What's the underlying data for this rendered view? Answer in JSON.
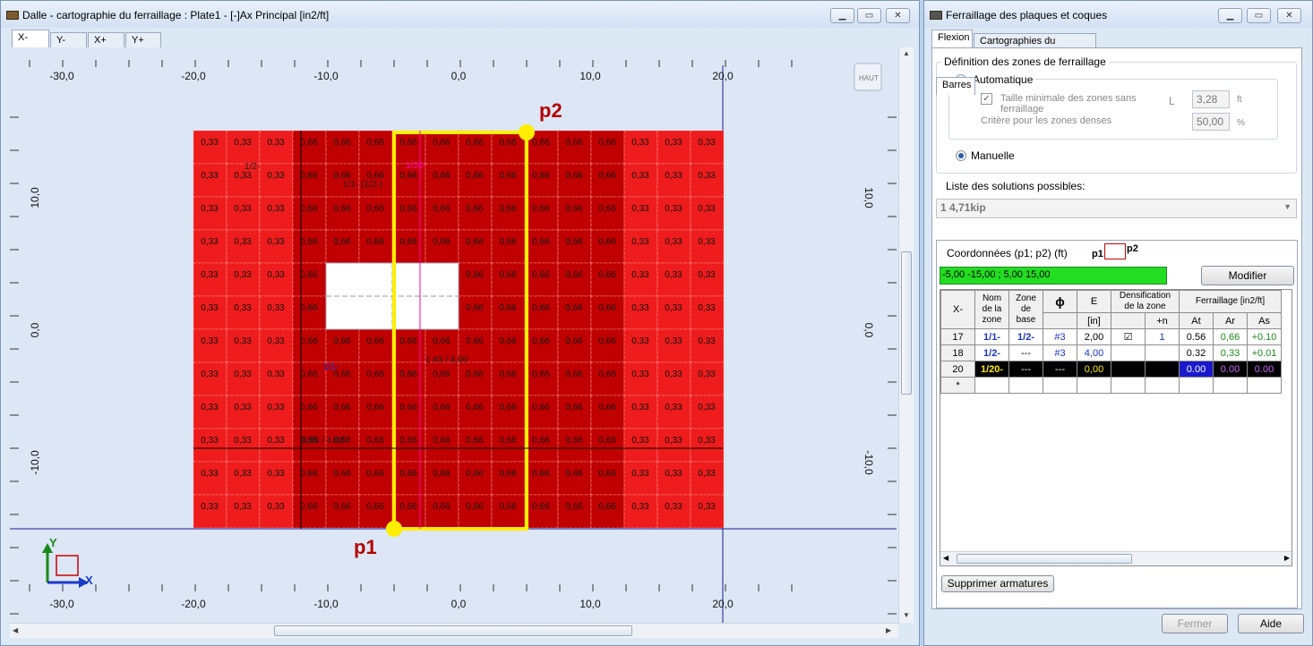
{
  "left_window": {
    "title": "Dalle - cartographie du ferraillage : Plate1 - [-]Ax Principal [in2/ft]",
    "controls": [
      "▁",
      "▭",
      "✕"
    ],
    "tabs": [
      "X-",
      "Y-",
      "X+",
      "Y+"
    ],
    "haut_label": "HAUT",
    "axis_top": [
      "-30,0",
      "-20,0",
      "-10,0",
      "0,0",
      "10,0",
      "20,0"
    ],
    "axis_bottom": [
      "-30,0",
      "-20,0",
      "-10,0",
      "0,0",
      "10,0",
      "20,0"
    ],
    "axis_left": [
      "10,0",
      "0,0",
      "-10,0"
    ],
    "axis_right": [
      "10,0",
      "0,0",
      "-10,0"
    ],
    "p1_label": "p1",
    "p2_label": "p2",
    "annotations": {
      "a1": "1/2-",
      "a2": "1/1- (1/2-)",
      "a3": "1/20-",
      "a4": "1/1-",
      "a5": "1 #3 / 4,00",
      "a6": "0,66 / 4,00"
    },
    "axis_icon": {
      "y": "Y",
      "x": "X"
    },
    "grid": {
      "rows": [
        [
          "0,33",
          "0,33",
          "0,33",
          "0,66",
          "0,66",
          "0,66",
          "0,66",
          "0,66",
          "0,66",
          "0,66",
          "0,66",
          "0,66",
          "0,66",
          "0,33",
          "0,33",
          "0,33"
        ],
        [
          "0,33",
          "0,33",
          "0,33",
          "0,66",
          "0,66",
          "0,66",
          "0,66",
          "0,66",
          "0,66",
          "0,66",
          "0,66",
          "0,66",
          "0,66",
          "0,33",
          "0,33",
          "0,33"
        ],
        [
          "0,33",
          "0,33",
          "0,33",
          "0,66",
          "0,66",
          "0,66",
          "0,66",
          "0,66",
          "0,66",
          "0,66",
          "0,66",
          "0,66",
          "0,66",
          "0,33",
          "0,33",
          "0,33"
        ],
        [
          "0,33",
          "0,33",
          "0,33",
          "0,66",
          "0,66",
          "0,66",
          "0,66",
          "0,66",
          "0,66",
          "0,66",
          "0,66",
          "0,66",
          "0,66",
          "0,33",
          "0,33",
          "0,33"
        ],
        [
          "0,33",
          "0,33",
          "0,33",
          "0,66",
          "",
          "",
          "",
          "",
          "0,66",
          "0,66",
          "0,66",
          "0,66",
          "0,66",
          "0,33",
          "0,33",
          "0,33"
        ],
        [
          "0,33",
          "0,33",
          "0,33",
          "0,66",
          "",
          "",
          "",
          "",
          "0,66",
          "0,66",
          "0,66",
          "0,66",
          "0,66",
          "0,33",
          "0,33",
          "0,33"
        ],
        [
          "0,33",
          "0,33",
          "0,33",
          "0,66",
          "0,66",
          "0,66",
          "0,66",
          "0,66",
          "0,66",
          "0,66",
          "0,66",
          "0,66",
          "0,66",
          "0,33",
          "0,33",
          "0,33"
        ],
        [
          "0,33",
          "0,33",
          "0,33",
          "0,66",
          "0,66",
          "0,66",
          "0,66",
          "0,66",
          "0,66",
          "0,66",
          "0,66",
          "0,66",
          "0,66",
          "0,33",
          "0,33",
          "0,33"
        ],
        [
          "0,33",
          "0,33",
          "0,33",
          "0,66",
          "0,66",
          "0,66",
          "0,66",
          "0,66",
          "0,66",
          "0,66",
          "0,66",
          "0,66",
          "0,66",
          "0,33",
          "0,33",
          "0,33"
        ],
        [
          "0,33",
          "0,33",
          "0,33",
          "0,66",
          "0,66",
          "0,66",
          "0,66",
          "0,66",
          "0,66",
          "0,66",
          "0,66",
          "0,66",
          "0,66",
          "0,33",
          "0,33",
          "0,33"
        ],
        [
          "0,33",
          "0,33",
          "0,33",
          "0,66",
          "0,66",
          "0,66",
          "0,66",
          "0,66",
          "0,66",
          "0,66",
          "0,66",
          "0,66",
          "0,66",
          "0,33",
          "0,33",
          "0,33"
        ],
        [
          "0,33",
          "0,33",
          "0,33",
          "0,66",
          "0,66",
          "0,66",
          "0,66",
          "0,66",
          "0,66",
          "0,66",
          "0,66",
          "0,66",
          "0,66",
          "0,33",
          "0,33",
          "0,33"
        ]
      ],
      "colors": {
        "light": "#ee1c1c",
        "dark": "#c00000",
        "hole": "#dce6f4",
        "highlight": "#ffee00"
      }
    }
  },
  "right_window": {
    "title": "Ferraillage des plaques et coques",
    "controls": [
      "▁",
      "▭",
      "✕"
    ],
    "tabs": [
      "Flexion",
      "Cartographies du ferraillage"
    ],
    "group_title": "Définition des zones de ferraillage",
    "auto_label": "Automatique",
    "taille_label": "Taille minimale des zones sans ferraillage",
    "critere_label": "Critère pour les zones denses",
    "l_label": "L",
    "taille_value": "3,28",
    "taille_unit": "ft",
    "critere_value": "50,00",
    "critere_unit": "%",
    "manuelle_label": "Manuelle",
    "liste_label": "Liste des solutions possibles:",
    "solution_value": "1   4,71kip",
    "barres_tab": "Barres",
    "coord_label": "Coordonnées (p1; p2) (ft)",
    "coord_p1": "p1",
    "coord_p2": "p2",
    "coord_value": "-5,00  -15,00 ;  5,00  15,00",
    "modifier_label": "Modifier",
    "table": {
      "h_x": "X-",
      "h_nom": "Nom de la zone",
      "h_zone": "Zone de base",
      "h_phi": "ϕ",
      "h_e": "E",
      "h_dens": "Densification de la zone",
      "h_ferr": "Ferraillage [in2/ft]",
      "sub_in": "[in]",
      "sub_n": "+n",
      "sub_at": "At",
      "sub_ar": "Ar",
      "sub_as": "As",
      "rows": [
        {
          "x": "17",
          "nom": "1/1-",
          "zone": "1/2-",
          "phi": "#3",
          "e": "2,00",
          "dens": "☑",
          "n": "1",
          "at": "0.56",
          "ar": "0,66",
          "as": "+0.10"
        },
        {
          "x": "18",
          "nom": "1/2-",
          "zone": "---",
          "phi": "#3",
          "e": "4,00",
          "dens": "",
          "n": "",
          "at": "0.32",
          "ar": "0,33",
          "as": "+0.01"
        },
        {
          "x": "20",
          "nom": "1/20-",
          "zone": "---",
          "phi": "---",
          "e": "0,00",
          "dens": "",
          "n": "",
          "at": "0.00",
          "ar": "0.00",
          "as": "0.00"
        },
        {
          "x": "*",
          "nom": "",
          "zone": "",
          "phi": "",
          "e": "",
          "dens": "",
          "n": "",
          "at": "",
          "ar": "",
          "as": ""
        }
      ]
    },
    "supprimer_label": "Supprimer armatures",
    "fermer_label": "Fermer",
    "aide_label": "Aide"
  }
}
